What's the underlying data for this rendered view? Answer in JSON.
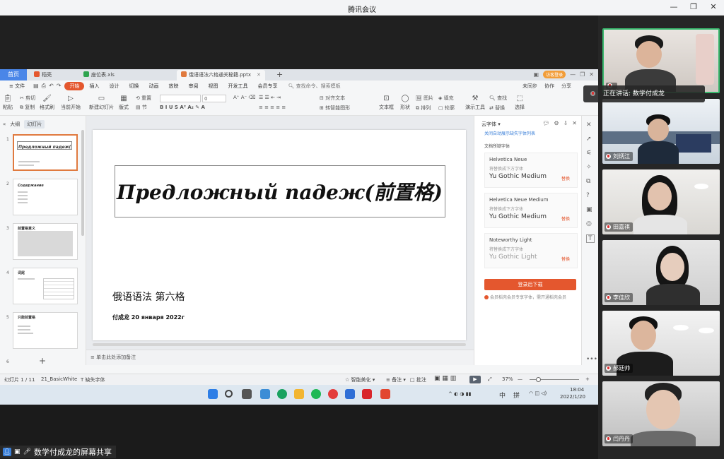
{
  "app": {
    "title": "腾讯会议",
    "window_controls": [
      "—",
      "❐",
      "✕"
    ]
  },
  "speaking": {
    "text": "正在讲话: 数学付成龙"
  },
  "share_label": "数学付成龙的屏幕共享",
  "participants": [
    {
      "name": ""
    },
    {
      "name": "刘炳江"
    },
    {
      "name": "田嘉祺"
    },
    {
      "name": "李佳欣"
    },
    {
      "name": "郝廷帅"
    },
    {
      "name": "闫丹丹"
    }
  ],
  "wps": {
    "home_tab": "首页",
    "tabs": [
      {
        "label": "稻壳",
        "color": "#e4572e"
      },
      {
        "label": "座位表.xls",
        "color": "#2ea44f"
      },
      {
        "label": "俄语语法六格通关秘籍.pptx",
        "color": "#e07a3f"
      }
    ],
    "visitor_badge": "访客登录",
    "menu": [
      "文件",
      "开始",
      "插入",
      "设计",
      "切换",
      "动画",
      "放映",
      "审阅",
      "视图",
      "开发工具",
      "会员专享"
    ],
    "active_menu": "开始",
    "search_placeholder": "查找命令、搜索模板",
    "menu_right": [
      "未同步",
      "协作",
      "分享"
    ],
    "ribbon": {
      "paste": "粘贴",
      "cut": "剪切",
      "copy": "复制",
      "format_painter": "格式刷",
      "play_from_current": "当前开始",
      "new_slide": "新建幻灯片",
      "layout": "版式",
      "section": "节",
      "reset": "重置",
      "font_size": "0",
      "align_text": "对齐文本",
      "convert_smartart": "转智能图形",
      "text_box": "文本框",
      "shape": "形状",
      "picture": "图片",
      "arrange": "排列",
      "fill": "填充",
      "outline": "轮廓",
      "presentation_tools": "演示工具",
      "find": "查找",
      "replace": "替换",
      "select": "选择"
    },
    "panel_tabs": [
      "大纲",
      "幻灯片"
    ],
    "active_panel_tab": "幻灯片",
    "slides": [
      {
        "num": "1",
        "label": "Предложный падеж(前置格)"
      },
      {
        "num": "2",
        "label": "Содержание"
      },
      {
        "num": "3",
        "label": "前置格意义"
      },
      {
        "num": "4",
        "label": "词尾"
      },
      {
        "num": "5",
        "label": "只能前置格"
      },
      {
        "num": "6",
        "label": ""
      }
    ],
    "slide": {
      "title": "Предложный падеж(前置格)",
      "subtitle": "俄语语法 第六格",
      "author": "付成龙 20 января 2022г"
    },
    "notes_placeholder": "单击此处添加备注",
    "font_panel": {
      "header": "云字体",
      "link": "关闭自动展示缺失字体列表",
      "section": "文档所缺字体",
      "fonts": [
        {
          "missing": "Helvetica Neue",
          "hint": "将替换成下方字体",
          "replacement": "Yu Gothic Medium",
          "action": "替换"
        },
        {
          "missing": "Helvetica Neue Medium",
          "hint": "将替换成下方字体",
          "replacement": "Yu Gothic Medium",
          "action": "替换"
        },
        {
          "missing": "Noteworthy Light",
          "hint": "将替换成下方字体",
          "replacement": "Yu Gothic Light",
          "action": "替换"
        }
      ],
      "download_button": "登录后下载",
      "note": "会员稻壳会员专享字体，需开通稻壳会员"
    },
    "status": {
      "slide_info": "幻灯片 1 / 11",
      "theme": "21_BasicWhite",
      "missing_fonts": "缺失字体",
      "beautify": "智能美化",
      "notes": "备注",
      "comments": "批注",
      "zoom": "37%"
    }
  },
  "taskbar": {
    "ime": "中",
    "ime2": "拼",
    "time": "18:04",
    "date": "2022/1/20"
  }
}
